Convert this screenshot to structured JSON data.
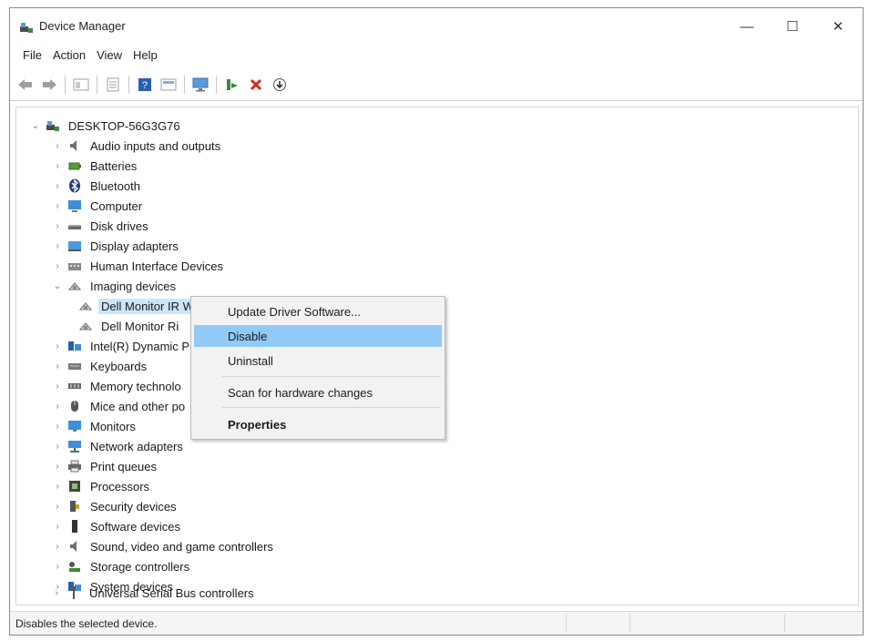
{
  "window": {
    "title": "Device Manager"
  },
  "window_controls": {
    "minimize": "—",
    "maximize": "☐",
    "close": "✕"
  },
  "menu": [
    "File",
    "Action",
    "View",
    "Help"
  ],
  "toolbar": [
    "back-arrow-icon",
    "forward-arrow-icon",
    "console-tree-icon",
    "properties-icon",
    "help-icon",
    "view-icon",
    "monitor-icon",
    "update-driver-icon",
    "uninstall-x-icon",
    "download-icon"
  ],
  "tree": {
    "root": "DESKTOP-56G3G76",
    "categories_before": [
      "Audio inputs and outputs",
      "Batteries",
      "Bluetooth",
      "Computer",
      "Disk drives",
      "Display adapters",
      "Human Interface Devices"
    ],
    "expanded_category": "Imaging devices",
    "children": [
      "Dell Monitor IR Webcam",
      "Dell Monitor Ri"
    ],
    "categories_after": [
      "Intel(R) Dynamic P",
      "Keyboards",
      "Memory technolo",
      "Mice and other po",
      "Monitors",
      "Network adapters",
      "Print queues",
      "Processors",
      "Security devices",
      "Software devices",
      "Sound, video and game controllers",
      "Storage controllers",
      "System devices",
      "Universal Serial Bus controllers"
    ]
  },
  "context_menu": {
    "update": "Update Driver Software...",
    "disable": "Disable",
    "uninstall": "Uninstall",
    "scan": "Scan for hardware changes",
    "properties": "Properties"
  },
  "status": {
    "text": "Disables the selected device."
  },
  "colors": {
    "highlight": "#91c9f7",
    "selection": "#cce6f9",
    "accent": "#2a76c6"
  }
}
